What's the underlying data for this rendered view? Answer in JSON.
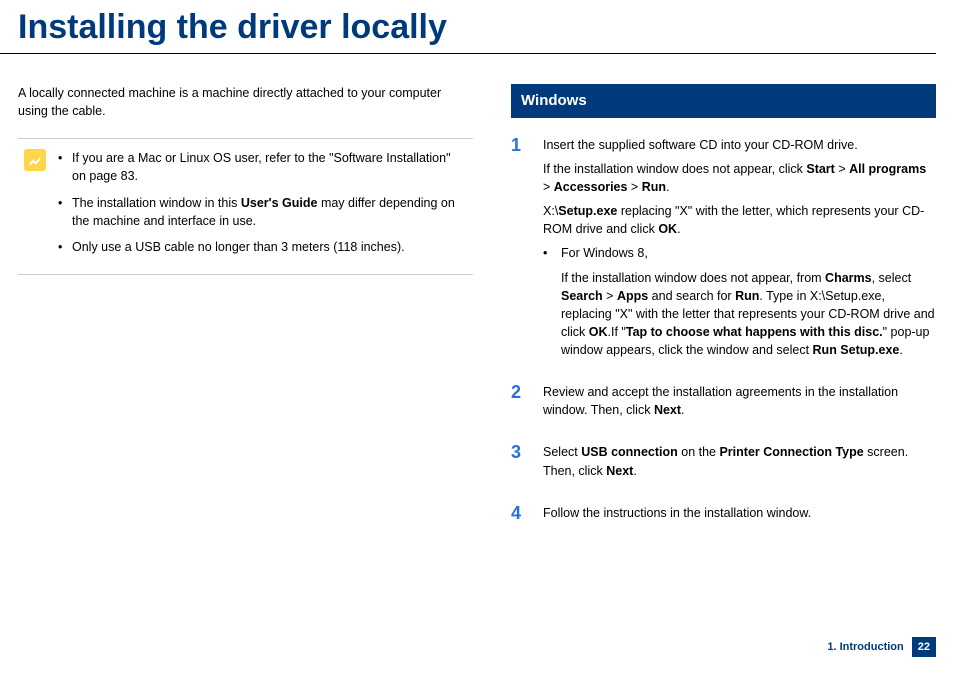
{
  "title": "Installing the driver locally",
  "intro": "A locally connected machine is a machine directly attached to your computer using the cable.",
  "note": {
    "items": [
      {
        "pre": "If you are a Mac or Linux OS user, refer to the \"Software Installation\" on page 83."
      },
      {
        "pre": "The installation window in this ",
        "bold": "User's Guide",
        "post": " may differ depending on the machine and interface in use."
      },
      {
        "pre": "Only use a USB cable no longer than 3 meters (118 inches)."
      }
    ]
  },
  "section_header": "Windows",
  "steps": {
    "s1": {
      "num": "1",
      "p1": "Insert the supplied software CD into your CD-ROM drive.",
      "p2_a": "If the installation window does not appear, click ",
      "p2_b": "Start",
      "p2_c": " > ",
      "p2_d": "All programs",
      "p2_e": " > ",
      "p2_f": "Accessories",
      "p2_g": " > ",
      "p2_h": "Run",
      "p2_i": ".",
      "p3_a": "X:\\",
      "p3_b": "Setup.exe",
      "p3_c": " replacing \"X\" with the letter, which represents your CD-ROM drive and click ",
      "p3_d": "OK",
      "p3_e": ".",
      "sub_label": "For Windows 8,",
      "sub_a": "If the installation window does not appear, from ",
      "sub_b": "Charms",
      "sub_c": ", select ",
      "sub_d": "Search",
      "sub_e": " > ",
      "sub_f": "Apps",
      "sub_g": " and search for ",
      "sub_h": "Run",
      "sub_i": ". Type in X:\\Setup.exe, replacing \"X\" with the letter that represents your CD-ROM drive and click ",
      "sub_j": "OK",
      "sub_k": ".If \"",
      "sub_l": "Tap to choose what happens with this disc.",
      "sub_m": "\" pop-up window appears, click the window and select ",
      "sub_n": "Run Setup.exe",
      "sub_o": "."
    },
    "s2": {
      "num": "2",
      "a": "Review and accept the installation agreements in the installation window. Then, click ",
      "b": "Next",
      "c": "."
    },
    "s3": {
      "num": "3",
      "a": "Select ",
      "b": "USB connection",
      "c": " on the ",
      "d": "Printer Connection Type",
      "e": " screen. Then, click ",
      "f": "Next",
      "g": "."
    },
    "s4": {
      "num": "4",
      "a": "Follow the instructions in the installation window."
    }
  },
  "footer": {
    "chapter": "1. Introduction",
    "page": "22"
  }
}
